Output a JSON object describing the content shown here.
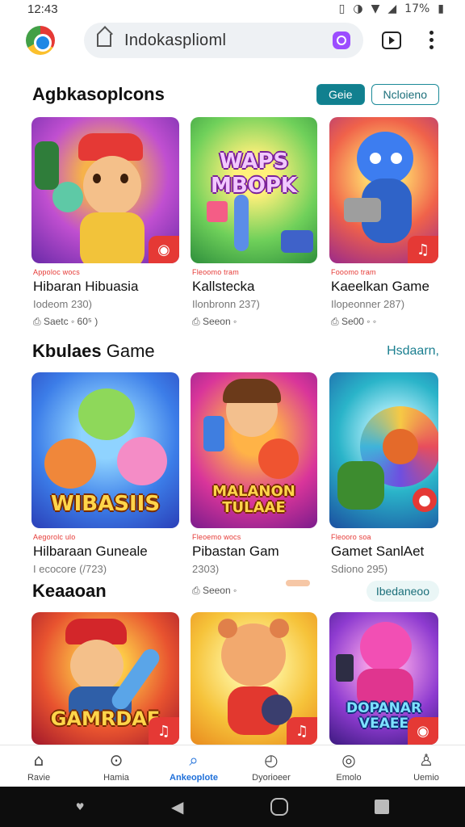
{
  "status_bar": {
    "time": "12:43",
    "battery": "17%",
    "icons": [
      "vibrate-icon",
      "data-saver-icon",
      "wifi-icon",
      "signal-icon",
      "battery-icon"
    ]
  },
  "browser": {
    "url": "Indokasplioml",
    "accent": "#9c4dff"
  },
  "section1": {
    "title": "Agbkasoplcons",
    "pill_primary": "Geie",
    "pill_secondary": "Ncloieno",
    "cards": [
      {
        "tag": "Appoloc wocs",
        "name": "Hibaran Hibuasia",
        "sub": "Iodeom 230)",
        "meta": "Saetc ◦ 60⁵ )",
        "art": "boy-hero"
      },
      {
        "tag": "Fleoomo tram",
        "name": "Kallstecka",
        "sub": "Ilonbronn 237)",
        "meta": "Seeon ◦",
        "art": "word-game"
      },
      {
        "tag": "Fooomo tram",
        "name": "Kaeelkan Game",
        "sub": "Ilopeonner 287)",
        "meta": "Se00 ◦ ◦",
        "art": "blue-cat"
      }
    ]
  },
  "section2": {
    "title_bold": "Kbulaes",
    "title_rest": "Game",
    "link": "Hsdaarn,",
    "cards": [
      {
        "tag": "Aegorolc ulo",
        "name": "Hilbaraan Guneale",
        "sub": "I ecocore (/723)",
        "art": "animals",
        "art_title": "WIBASIIS"
      },
      {
        "tag": "Fleoemo wocs",
        "name": "Pibastan Gam",
        "sub": "2303)",
        "meta": "Seeon ◦",
        "art": "boy-dragon",
        "art_title": "MALANON TULAAE"
      },
      {
        "tag": "Fleooro soa",
        "name": "Gamet SanlAet",
        "sub": "Sdiono 295)",
        "art": "colour-wheel"
      }
    ]
  },
  "section3": {
    "title": "Keaaoan",
    "pill": "Ibedaneoo",
    "cards": [
      {
        "art": "boy-cap",
        "art_title": "GAMRDAE"
      },
      {
        "art": "bear"
      },
      {
        "art": "pink-cat",
        "art_title": "DOPANAR VEAEE"
      }
    ]
  },
  "bottom_nav": [
    {
      "label": "Ravie",
      "icon": "home-icon"
    },
    {
      "label": "Hamia",
      "icon": "compass-icon"
    },
    {
      "label": "Ankeoplote",
      "icon": "search-icon",
      "active": true
    },
    {
      "label": "Dyorioeer",
      "icon": "alert-icon"
    },
    {
      "label": "Emolo",
      "icon": "location-icon"
    },
    {
      "label": "Uemio",
      "icon": "person-icon"
    }
  ]
}
